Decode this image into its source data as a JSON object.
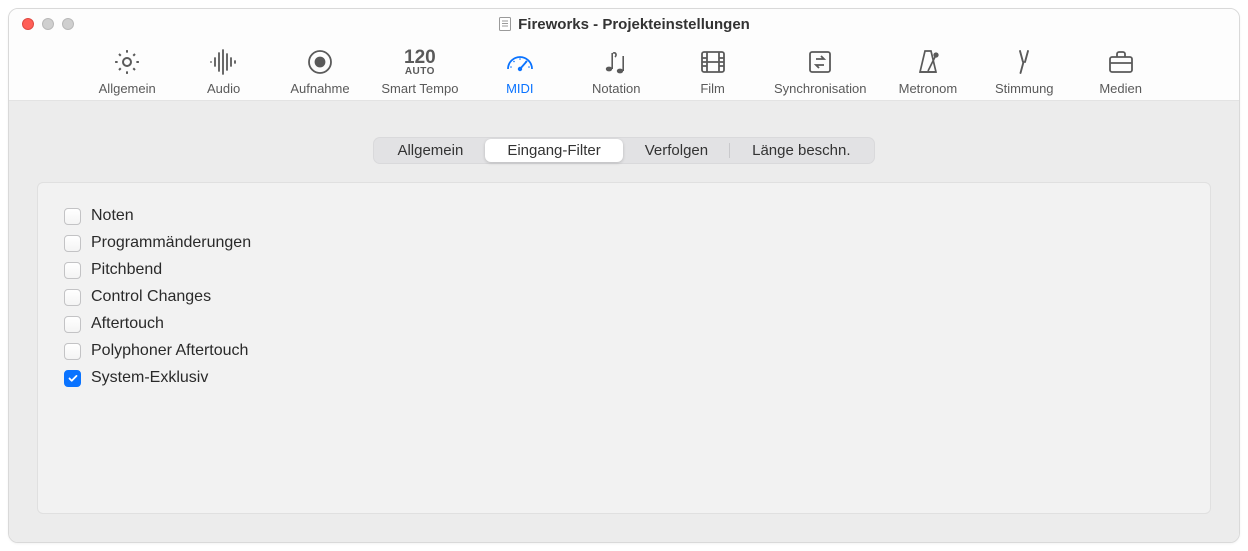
{
  "window": {
    "title": "Fireworks - Projekteinstellungen"
  },
  "toolbar": {
    "items": [
      {
        "label": "Allgemein"
      },
      {
        "label": "Audio"
      },
      {
        "label": "Aufnahme"
      },
      {
        "label": "Smart Tempo"
      },
      {
        "label": "MIDI"
      },
      {
        "label": "Notation"
      },
      {
        "label": "Film"
      },
      {
        "label": "Synchronisation"
      },
      {
        "label": "Metronom"
      },
      {
        "label": "Stimmung"
      },
      {
        "label": "Medien"
      }
    ],
    "tempo_number": "120",
    "tempo_mode": "AUTO",
    "selected_index": 4
  },
  "subtabs": {
    "items": [
      {
        "label": "Allgemein"
      },
      {
        "label": "Eingang-Filter"
      },
      {
        "label": "Verfolgen"
      },
      {
        "label": "Länge beschn."
      }
    ],
    "selected_index": 1
  },
  "filters": [
    {
      "label": "Noten",
      "checked": false
    },
    {
      "label": "Programmänderungen",
      "checked": false
    },
    {
      "label": "Pitchbend",
      "checked": false
    },
    {
      "label": "Control Changes",
      "checked": false
    },
    {
      "label": "Aftertouch",
      "checked": false
    },
    {
      "label": "Polyphoner Aftertouch",
      "checked": false
    },
    {
      "label": "System-Exklusiv",
      "checked": true
    }
  ]
}
